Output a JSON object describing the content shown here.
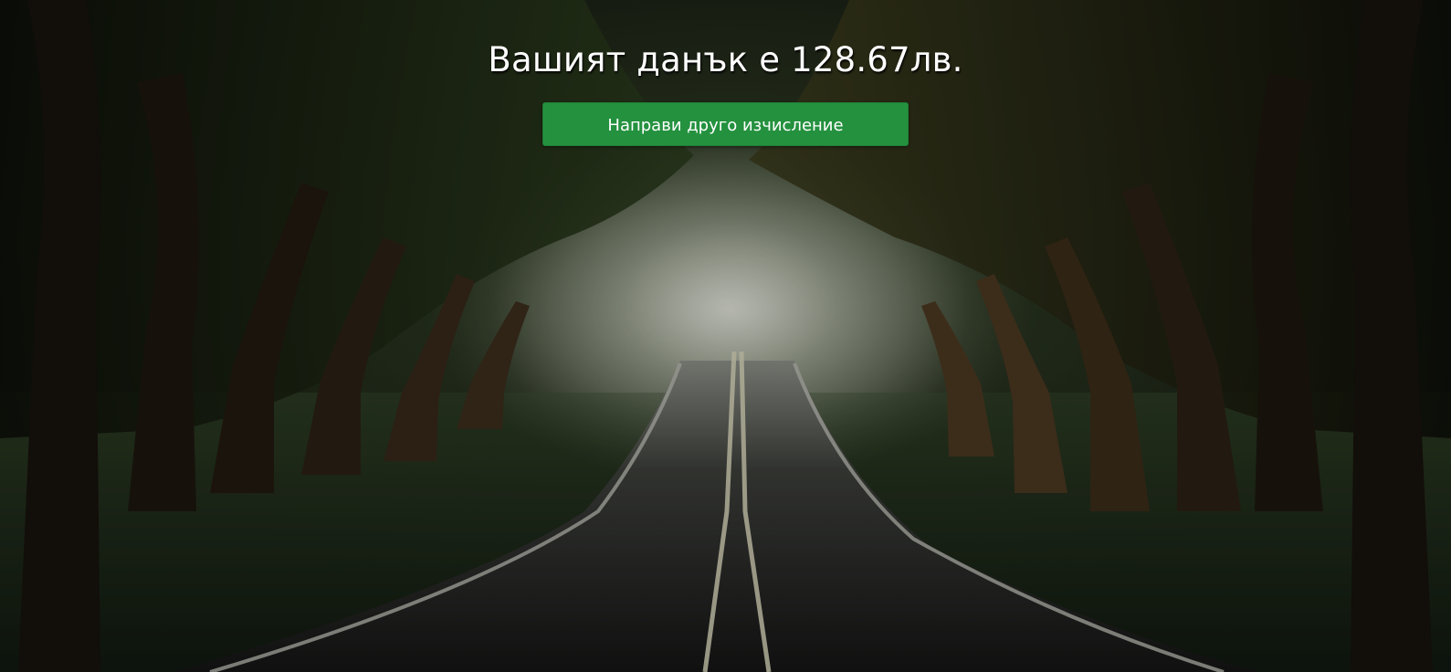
{
  "result": {
    "message": "Вашият данък е 128.67лв."
  },
  "actions": {
    "recalculate_label": "Направи друго изчисление"
  },
  "colors": {
    "button_green": "#24913e",
    "title_text": "#ffffff"
  },
  "background": {
    "icon": "forest-road-image"
  }
}
